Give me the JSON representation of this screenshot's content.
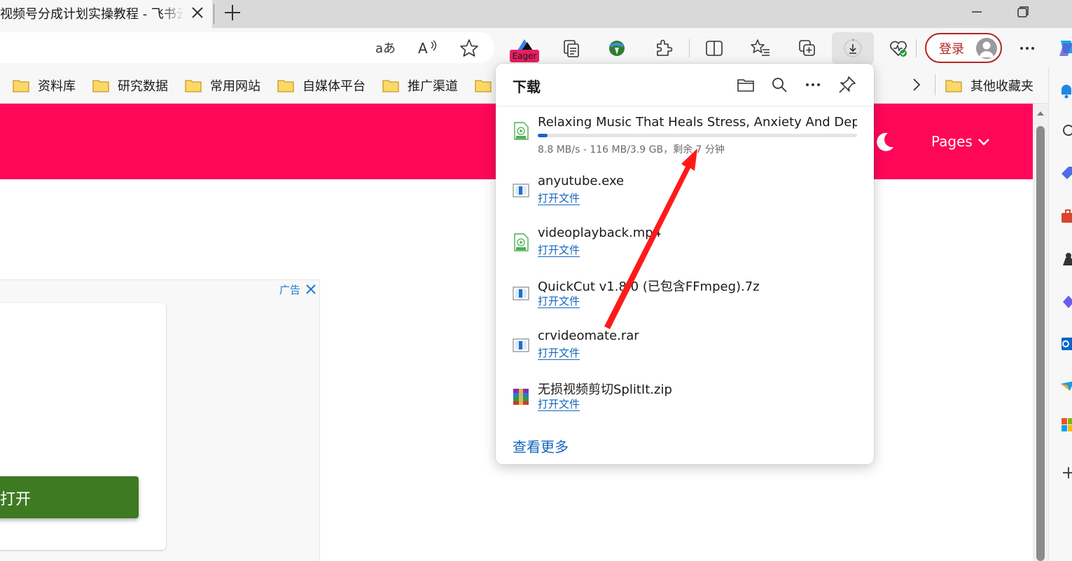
{
  "tab": {
    "title": "视频号分成计划实操教程 - 飞书云文档"
  },
  "toolbar": {
    "extension_badge": "Eager",
    "login_label": "登录"
  },
  "bookmarks": {
    "items": [
      {
        "label": "资料库"
      },
      {
        "label": "研究数据"
      },
      {
        "label": "常用网站"
      },
      {
        "label": "自媒体平台"
      },
      {
        "label": "推广渠道"
      }
    ],
    "other": "其他收藏夹"
  },
  "page": {
    "nav_pages": "Pages",
    "ad_label": "广告",
    "ad_button": "打开"
  },
  "downloads": {
    "title": "下载",
    "active": {
      "name": "Relaxing Music That Heals Stress, Anxiety And Dep...",
      "progress": 0.03,
      "status": "8.8 MB/s - 116 MB/3.9 GB，剩余 7 分钟"
    },
    "items": [
      {
        "name": "anyutube.exe",
        "action": "打开文件",
        "icon": "file-icon"
      },
      {
        "name": "videoplayback.mp4",
        "action": "打开文件",
        "icon": "video-file-icon"
      },
      {
        "name": "QuickCut v1.8.0 (已包含FFmpeg).7z",
        "action": "打开文件",
        "icon": "file-icon"
      },
      {
        "name": "crvideomate.rar",
        "action": "打开文件",
        "icon": "file-icon"
      },
      {
        "name": "无损视频剪切SplitIt.zip",
        "action": "打开文件",
        "icon": "archive-icon"
      }
    ],
    "see_more": "查看更多"
  },
  "colors": {
    "brand_header": "#fe0759",
    "link": "#1666c0",
    "login": "#b32424",
    "ad_button": "#3d7a22",
    "arrow": "#ff1a1a"
  }
}
